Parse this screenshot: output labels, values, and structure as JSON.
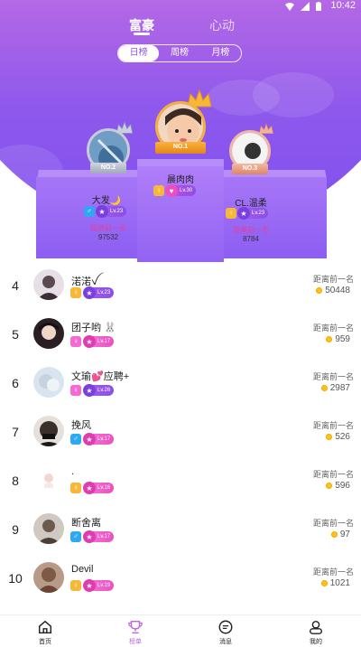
{
  "status_bar": {
    "time": "10:42"
  },
  "main_tabs": [
    {
      "label": "富豪",
      "active": true
    },
    {
      "label": "心动",
      "active": false
    }
  ],
  "period_tabs": [
    {
      "label": "日榜",
      "active": true
    },
    {
      "label": "周榜",
      "active": false
    },
    {
      "label": "月榜",
      "active": false
    }
  ],
  "podium": {
    "first": {
      "badge": "NO.1",
      "name": "晨肉肉",
      "level": "Lv.30"
    },
    "second": {
      "badge": "NO.2",
      "name": "大发🌙",
      "level": "Lv.23",
      "gap_label": "距离前一名",
      "score": "97532"
    },
    "third": {
      "badge": "NO.3",
      "name": "CL.温柔",
      "level": "Lv.23",
      "gap_label": "距离前一名",
      "score": "8784"
    }
  },
  "list": [
    {
      "rank": "4",
      "name": "渃渃ꪜ",
      "gender": "female",
      "level": "Lv.23",
      "gap_label": "距离前一名",
      "score": "50448"
    },
    {
      "rank": "5",
      "name": "团子哟 🐰",
      "gender": "female",
      "level": "Lv.17",
      "gap_label": "距离前一名",
      "score": "959"
    },
    {
      "rank": "6",
      "name": "文瑜💕应聘+",
      "gender": "female",
      "level": "Lv.26",
      "gap_label": "距离前一名",
      "score": "2987"
    },
    {
      "rank": "7",
      "name": "挽风",
      "gender": "male",
      "level": "Lv.17",
      "gap_label": "距离前一名",
      "score": "526"
    },
    {
      "rank": "8",
      "name": ".",
      "gender": "female",
      "level": "Lv.16",
      "gap_label": "距离前一名",
      "score": "596"
    },
    {
      "rank": "9",
      "name": "断舍离",
      "gender": "male",
      "level": "Lv.17",
      "gap_label": "距离前一名",
      "score": "97"
    },
    {
      "rank": "10",
      "name": "Devil",
      "gender": "female",
      "level": "Lv.19",
      "gap_label": "距离前一名",
      "score": "1021"
    }
  ],
  "bottom_nav": [
    {
      "label": "首页",
      "icon": "home-icon",
      "active": false
    },
    {
      "label": "榜单",
      "icon": "trophy-icon",
      "active": true
    },
    {
      "label": "消息",
      "icon": "message-icon",
      "active": false
    },
    {
      "label": "我的",
      "icon": "profile-icon",
      "active": false
    }
  ],
  "colors": {
    "accent": "#c066e0",
    "male": "#2fa8f2",
    "female": "#f36ad4",
    "level_pink": "#ec4fc0",
    "level_purple": "#8b4fe6"
  }
}
